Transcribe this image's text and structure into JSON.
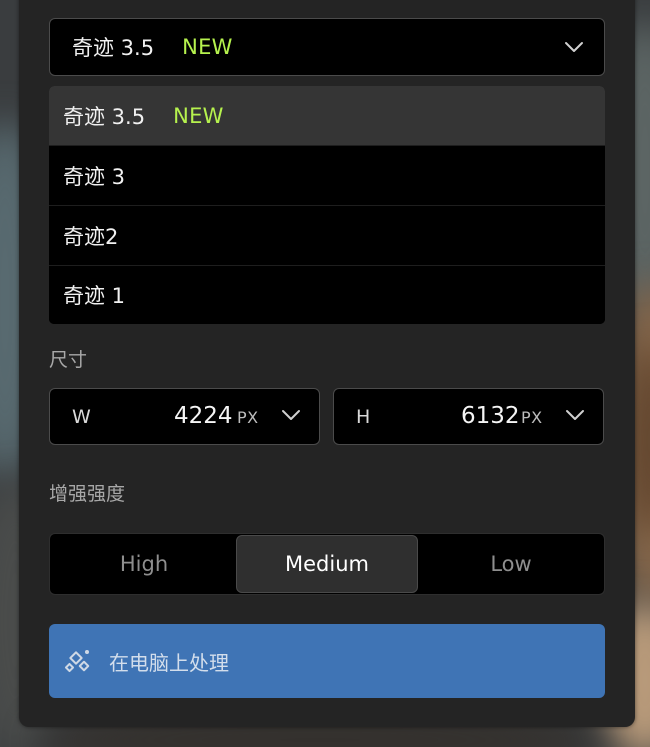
{
  "model_select": {
    "current": {
      "name": "奇迹 3.5",
      "badge": "NEW"
    }
  },
  "model_options": [
    {
      "name": "奇迹 3.5",
      "badge": "NEW",
      "selected": true
    },
    {
      "name": "奇迹 3",
      "badge": "",
      "selected": false
    },
    {
      "name": "奇迹2",
      "badge": "",
      "selected": false
    },
    {
      "name": "奇迹 1",
      "badge": "",
      "selected": false
    }
  ],
  "size": {
    "label": "尺寸",
    "width": {
      "axis": "W",
      "value": "4224",
      "unit": "PX"
    },
    "height": {
      "axis": "H",
      "value": "6132",
      "unit": "PX"
    }
  },
  "enhance": {
    "label": "增强强度",
    "options": [
      "High",
      "Medium",
      "Low"
    ],
    "selected": "Medium"
  },
  "process_button": {
    "label": "在电脑上处理",
    "icon": "sparkle-diamond-icon"
  },
  "colors": {
    "badge_new": "#b6f24e",
    "button_bg": "#3f74b5",
    "panel_bg": "#242424"
  }
}
